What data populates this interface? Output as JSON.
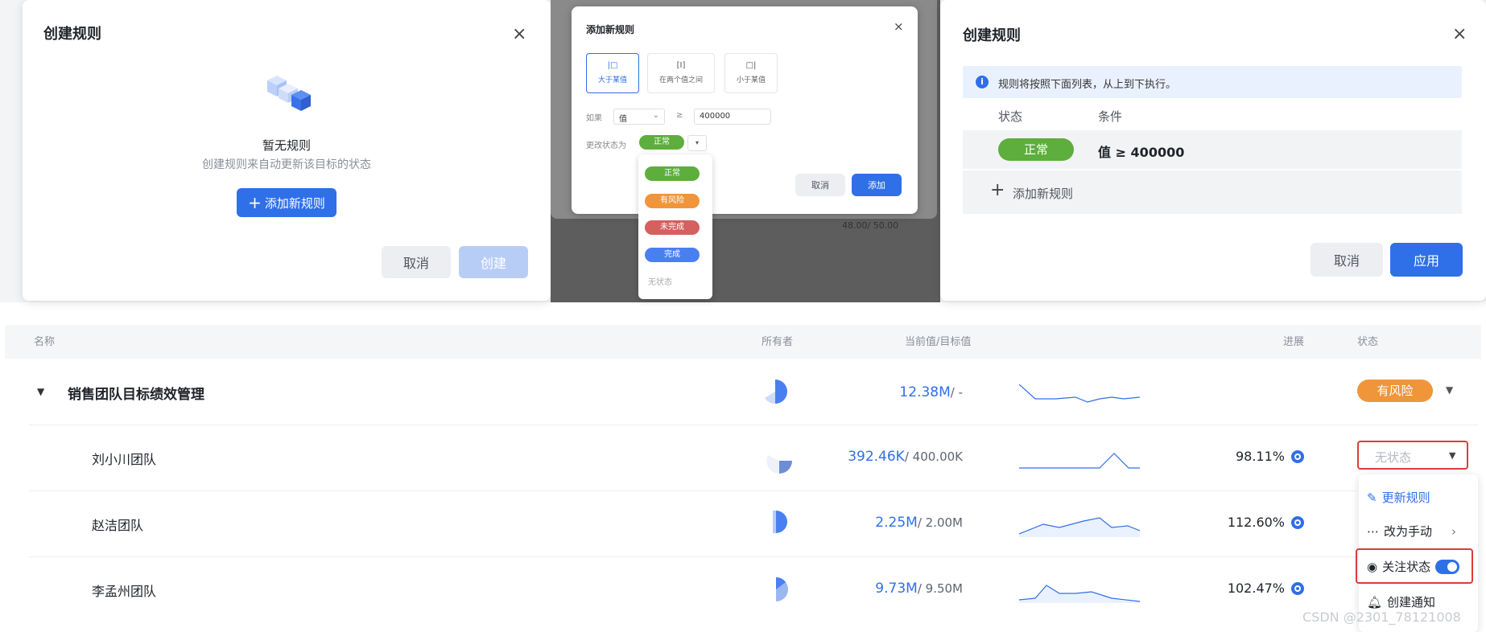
{
  "left_dialog": {
    "title": "创建规则",
    "empty_title": "暂无规则",
    "empty_desc": "创建规则来自动更新该目标的状态",
    "add_label": "添加新规则",
    "cancel_label": "取消",
    "create_label": "创建"
  },
  "mid_dialog": {
    "title": "添加新规则",
    "types": [
      {
        "symbol": "|□",
        "label": "大于某值"
      },
      {
        "symbol": "[I]",
        "label": "在两个值之间"
      },
      {
        "symbol": "□|",
        "label": "小于某值"
      }
    ],
    "if_label": "如果",
    "field_value": "值",
    "operator": "≥",
    "threshold": "400000",
    "change_label": "更改状态为",
    "selected_status": "正常",
    "cancel_label": "取消",
    "add_label": "添加",
    "options": [
      "正常",
      "有风险",
      "未完成",
      "完成",
      "无状态"
    ],
    "background_value": "48.00/ 50.00"
  },
  "right_dialog": {
    "title": "创建规则",
    "info": "规则将按照下面列表，从上到下执行。",
    "col_status": "状态",
    "col_condition": "条件",
    "rule_status": "正常",
    "rule_condition": "值 ≥ 400000",
    "add_label": "添加新规则",
    "cancel_label": "取消",
    "apply_label": "应用"
  },
  "table": {
    "headers": {
      "name": "名称",
      "owner": "所有者",
      "value": "当前值/目标值",
      "progress": "进展",
      "status": "状态"
    },
    "rows": [
      {
        "name": "销售团队目标绩效管理",
        "current": "12.38M",
        "target": "/ -",
        "progress": "",
        "status": "有风险"
      },
      {
        "name": "刘小川团队",
        "current": "392.46K",
        "target": "/ 400.00K",
        "progress": "98.11%",
        "status": "无状态"
      },
      {
        "name": "赵洁团队",
        "current": "2.25M",
        "target": "/ 2.00M",
        "progress": "112.60%",
        "status": ""
      },
      {
        "name": "李孟州团队",
        "current": "9.73M",
        "target": "/ 9.50M",
        "progress": "102.47%",
        "status": ""
      }
    ]
  },
  "popup": {
    "items": [
      "更新规则",
      "改为手动",
      "关注状态",
      "创建通知"
    ]
  },
  "watermark": "CSDN @2301_78121008",
  "colors": {
    "blue": "#2f6fe8",
    "green": "#5dae3c",
    "orange": "#f0953a",
    "red": "#d65f5f",
    "highlight": "#e03a3a"
  }
}
